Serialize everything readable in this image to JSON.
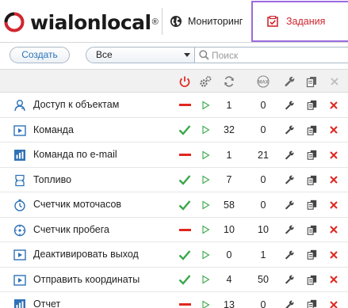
{
  "header": {
    "logo_text": "wialonlocal",
    "logo_mark": "®",
    "nav_monitoring": "Мониторинг",
    "nav_tasks": "Задания"
  },
  "toolbar": {
    "create_label": "Создать",
    "filter_value": "Все",
    "search_placeholder": "Поиск"
  },
  "columns": [
    {
      "icon": "power-icon"
    },
    {
      "icon": "gears-icon"
    },
    {
      "icon": "repeat-icon"
    },
    {
      "icon": "max-icon",
      "label": "MAX"
    },
    {
      "icon": "wrench-icon"
    },
    {
      "icon": "copy-icon"
    },
    {
      "icon": "close-icon"
    }
  ],
  "colors": {
    "enabled": "#3aa84a",
    "disabled": "#e0271f",
    "accent_blue": "#2a74b8",
    "tasks_active_border": "#9b6be0"
  },
  "tasks": [
    {
      "name": "Доступ к объектам",
      "type": "access-icon",
      "enabled": false,
      "count": "1",
      "max": "0"
    },
    {
      "name": "Команда",
      "type": "command-icon",
      "enabled": true,
      "count": "32",
      "max": "0"
    },
    {
      "name": "Команда по e-mail",
      "type": "email-command-icon",
      "enabled": false,
      "count": "1",
      "max": "21"
    },
    {
      "name": "Топливо",
      "type": "fuel-icon",
      "enabled": true,
      "count": "7",
      "max": "0"
    },
    {
      "name": "Счетчик моточасов",
      "type": "engine-hours-icon",
      "enabled": true,
      "count": "58",
      "max": "0"
    },
    {
      "name": "Счетчик пробега",
      "type": "mileage-icon",
      "enabled": false,
      "count": "10",
      "max": "10"
    },
    {
      "name": "Деактивировать выход",
      "type": "command-icon",
      "enabled": true,
      "count": "0",
      "max": "1"
    },
    {
      "name": "Отправить координаты",
      "type": "command-icon",
      "enabled": true,
      "count": "4",
      "max": "50"
    },
    {
      "name": "Отчет",
      "type": "report-icon",
      "enabled": false,
      "count": "13",
      "max": "0"
    }
  ]
}
